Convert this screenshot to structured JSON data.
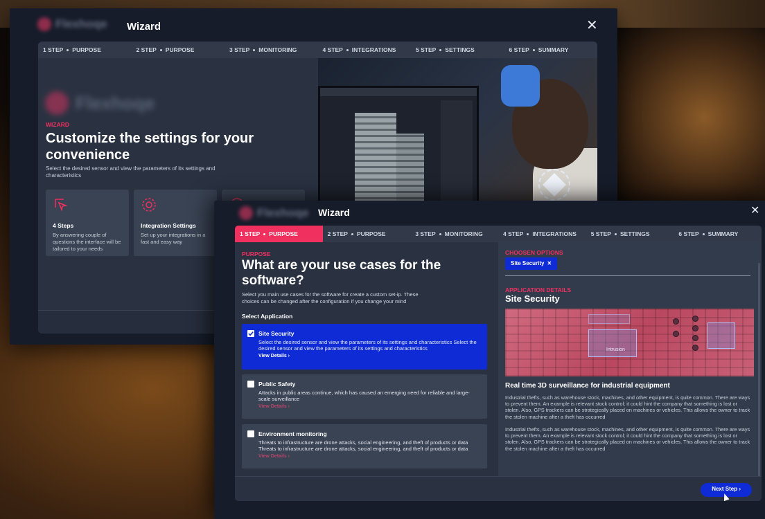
{
  "back_window": {
    "logo_text": "Flexhoqe",
    "title": "Wizard",
    "close_label": "✕",
    "steps": [
      {
        "num": "1 STEP",
        "name": "PURPOSE"
      },
      {
        "num": "2 STEP",
        "name": "PURPOSE"
      },
      {
        "num": "3 STEP",
        "name": "MONITORING"
      },
      {
        "num": "4 STEP",
        "name": "INTEGRATIONS"
      },
      {
        "num": "5 STEP",
        "name": "SETTINGS"
      },
      {
        "num": "6 STEP",
        "name": "SUMMARY"
      }
    ],
    "eyebrow": "WIZARD",
    "heading": "Customize the settings for your convenience",
    "subtitle": "Select the desired sensor and view the parameters of its settings and characteristics",
    "cards": [
      {
        "icon": "cursor-click-icon",
        "title": "4 Steps",
        "desc": "By answering couple of questions the interface will be tailored to your needs"
      },
      {
        "icon": "gear-icon",
        "title": "Integration Settings",
        "desc": "Set up your integrations in a fast and easy way"
      }
    ]
  },
  "front_window": {
    "logo_text": "Flexhoqe",
    "title": "Wizard",
    "close_label": "✕",
    "steps": [
      {
        "num": "1 STEP",
        "name": "PURPOSE"
      },
      {
        "num": "2 STEP",
        "name": "PURPOSE"
      },
      {
        "num": "3 STEP",
        "name": "MONITORING"
      },
      {
        "num": "4 STEP",
        "name": "INTEGRATIONS"
      },
      {
        "num": "5 STEP",
        "name": "SETTINGS"
      },
      {
        "num": "6 STEP",
        "name": "SUMMARY"
      }
    ],
    "eyebrow": "PURPOSE",
    "heading": "What are your use cases for the software?",
    "subtitle": "Select you main use cases for the software for create a custom set-ip. These choices can be changed after the configuration if you change your mind",
    "select_label": "Select Application",
    "options": [
      {
        "title": "Site Security",
        "desc": "Select the desired sensor and view the parameters of its settings and characteristics Select the desired sensor and view the parameters of its settings and characteristics",
        "link": "View Details ›",
        "checked": true
      },
      {
        "title": "Public Safety",
        "desc": "Attacks in public areas continue, which has caused an emerging need for reliable and large-scale surveillance",
        "link": "View Details ›",
        "checked": false
      },
      {
        "title": "Environment monitoring",
        "desc": "Threats to infrastructure are drone attacks, social engineering, and theft of products or data Threats to infrastructure are drone attacks, social engineering, and theft of products or data",
        "link": "View Details ›",
        "checked": false
      }
    ],
    "chosen_label": "CHOOSEN OPTIONS",
    "chip_label": "Site Security",
    "chip_remove": "✕",
    "details_label": "APPLICATION DETAILS",
    "details_title": "Site Security",
    "image_label": "Intrusion",
    "feature_title": "Real time 3D surveillance for industrial equipment",
    "paragraphs": [
      "Industrial thefts, such as warehouse stock, machines, and other equipment, is quite common. There are ways to prevent them. An example is relevant stock control; it could hint the company that something is lost or stolen. Also, GPS trackers can be strategically placed on machines or vehicles. This allows the owner to track the stolen machine after a theft has occurred",
      "Industrial thefts, such as warehouse stock, machines, and other equipment, is quite common. There are ways to prevent them. An example is relevant stock control; it could hint the company that something is lost or stolen. Also, GPS trackers can be strategically placed on machines or vehicles. This allows the owner to track the stolen machine after a theft has occurred"
    ],
    "next_button": "Next Step ›"
  },
  "colors": {
    "accent_pink": "#f0305f",
    "accent_blue": "#0f2bd6",
    "panel": "#2a3242",
    "window": "#161c2a"
  }
}
